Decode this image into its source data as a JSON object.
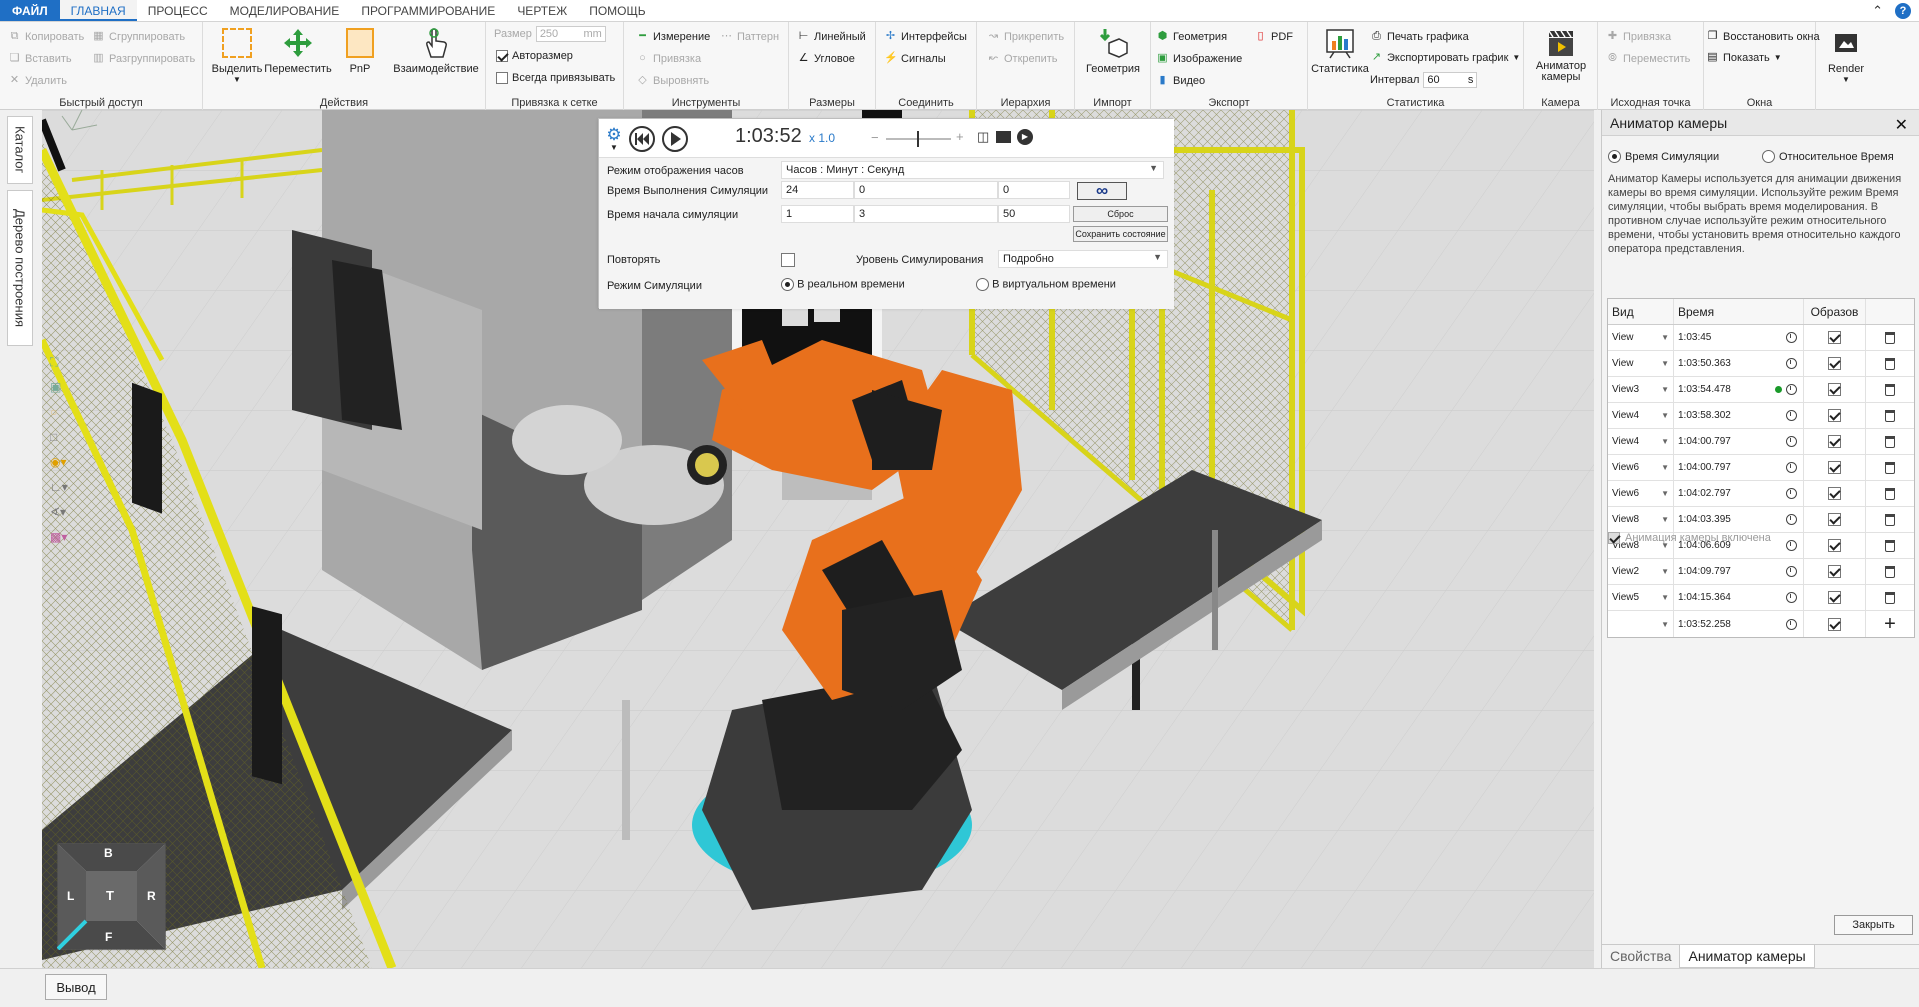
{
  "menu": {
    "items": [
      "ФАЙЛ",
      "ГЛАВНАЯ",
      "ПРОЦЕСС",
      "МОДЕЛИРОВАНИЕ",
      "ПРОГРАММИРОВАНИЕ",
      "ЧЕРТЕЖ",
      "ПОМОЩЬ"
    ],
    "active_index": 1
  },
  "ribbon": {
    "quick_access": {
      "title": "Быстрый доступ",
      "copy": "Копировать",
      "paste": "Вставить",
      "delete": "Удалить",
      "group": "Сгруппировать",
      "ungroup": "Разгруппировать"
    },
    "actions": {
      "title": "Действия",
      "select": "Выделить",
      "move": "Переместить",
      "pnp": "PnP",
      "interact": "Взаимодействие"
    },
    "grid_snap": {
      "title": "Привязка к сетке",
      "size_label": "Размер",
      "size_value": "250",
      "size_unit": "mm",
      "autosize": "Авторазмер",
      "always_snap": "Всегда привязывать"
    },
    "tools": {
      "title": "Инструменты",
      "measure": "Измерение",
      "pattern": "Паттерн",
      "snap": "Привязка",
      "align": "Выровнять"
    },
    "dimensions": {
      "title": "Размеры",
      "linear": "Линейный",
      "angular": "Угловое"
    },
    "connect": {
      "title": "Соединить",
      "interfaces": "Интерфейсы",
      "signals": "Сигналы"
    },
    "hierarchy": {
      "title": "Иерархия",
      "attach": "Прикрепить",
      "detach": "Открепить"
    },
    "import": {
      "title": "Импорт",
      "geometry": "Геометрия"
    },
    "export": {
      "title": "Экспорт",
      "geometry": "Геометрия",
      "image": "Изображение",
      "video": "Видео",
      "pdf": "PDF"
    },
    "statistics": {
      "title": "Статистика",
      "stats": "Статистика",
      "print_chart": "Печать графика",
      "export_chart": "Экспортировать график",
      "interval_label": "Интервал",
      "interval_value": "60",
      "interval_unit": "s"
    },
    "camera": {
      "title": "Камера",
      "animator": "Аниматор камеры"
    },
    "origin": {
      "title": "Исходная точка",
      "snap": "Привязка",
      "move": "Переместить"
    },
    "windows": {
      "title": "Окна",
      "restore": "Восстановить окна",
      "show": "Показать"
    },
    "render": {
      "label": "Render"
    }
  },
  "left_tabs": {
    "catalog": "Каталог",
    "tree": "Дерево построения"
  },
  "sim": {
    "time": "1:03:52",
    "speed": "x  1.0",
    "clock_mode_label": "Режим отображения часов",
    "clock_mode_value": "Часов          : Минут            : Секунд",
    "run_time_label": "Время Выполнения Симуляции",
    "run_time": [
      "24",
      "0",
      "0"
    ],
    "start_time_label": "Время начала симуляции",
    "start_time": [
      "1",
      "3",
      "50"
    ],
    "reset": "Сброс",
    "save_state": "Сохранить состояние",
    "repeat_label": "Повторять",
    "level_label": "Уровень Симулирования",
    "level_value": "Подробно",
    "mode_label": "Режим Симуляции",
    "mode_realtime": "В реальном времени",
    "mode_virtual": "В виртуальном времени"
  },
  "navcube": {
    "top": "B",
    "bottom": "F",
    "left": "L",
    "right": "R",
    "center": "T"
  },
  "panel": {
    "title": "Аниматор камеры",
    "radio_sim": "Время Симуляции",
    "radio_rel": "Относительное Время",
    "description": "Аниматор Камеры используется для анимации движения камеры во время симуляции. Используйте режим Время симуляции, чтобы выбрать время моделирования. В противном случае используйте режим относительного времени, чтобы установить время относительно каждого оператора представления.",
    "columns": [
      "Вид",
      "Время",
      "Образов",
      ""
    ],
    "rows": [
      {
        "view": "View",
        "time": "1:03:45",
        "active": false
      },
      {
        "view": "View",
        "time": "1:03:50.363",
        "active": false
      },
      {
        "view": "View3",
        "time": "1:03:54.478",
        "active": true
      },
      {
        "view": "View4",
        "time": "1:03:58.302",
        "active": false
      },
      {
        "view": "View4",
        "time": "1:04:00.797",
        "active": false
      },
      {
        "view": "View6",
        "time": "1:04:00.797",
        "active": false
      },
      {
        "view": "View6",
        "time": "1:04:02.797",
        "active": false
      },
      {
        "view": "View8",
        "time": "1:04:03.395",
        "active": false
      },
      {
        "view": "View8",
        "time": "1:04:06.609",
        "active": false
      },
      {
        "view": "View2",
        "time": "1:04:09.797",
        "active": false
      },
      {
        "view": "View5",
        "time": "1:04:15.364",
        "active": false
      }
    ],
    "new_row_time": "1:03:52.258",
    "enabled_label": "Анимация камеры включена",
    "close_btn": "Закрыть",
    "tabs": [
      "Свойства",
      "Аниматор камеры"
    ]
  },
  "bottom": {
    "output": "Вывод"
  },
  "colors": {
    "accent": "#1f6fc5",
    "robot": "#e8701c",
    "fence": "#e6e21b"
  }
}
